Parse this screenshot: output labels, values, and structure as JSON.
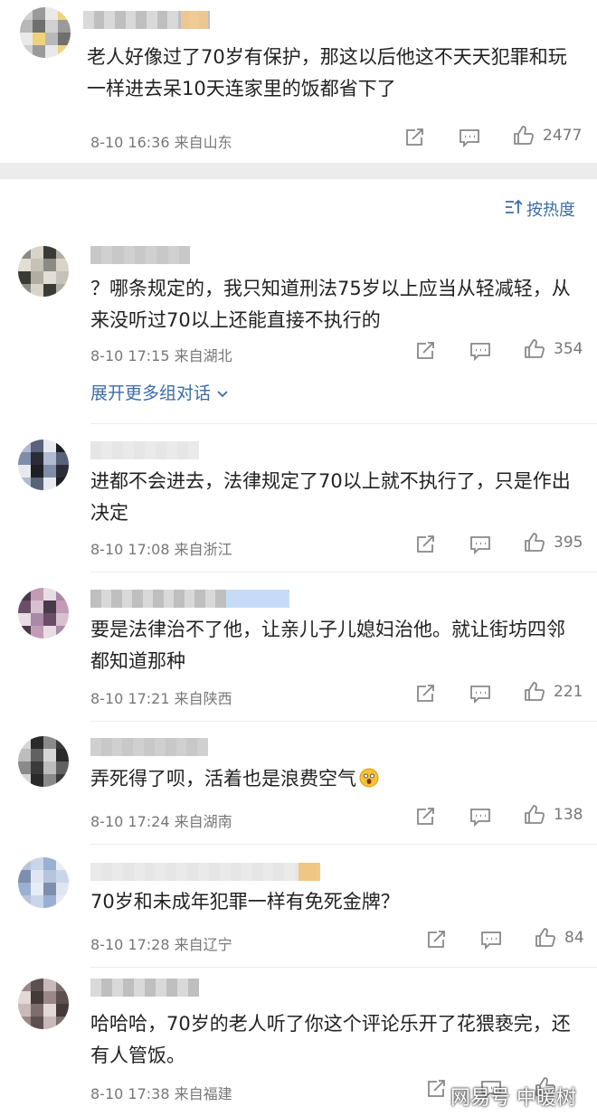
{
  "sort_label": "按热度",
  "expand_more": "展开更多组对话",
  "watermark": "网易号 中暖树",
  "colors": {
    "accent": "#3a6da8",
    "meta": "#777777",
    "separator": "#ececec"
  },
  "comments": [
    {
      "text": "老人好像过了70岁有保护，那这以后他这不天天犯罪和玩一样进去呆10天连家里的饭都省下了",
      "time": "8-10 16:36",
      "location": "来自山东",
      "likes": "2477"
    },
    {
      "text": "？哪条规定的，我只知道刑法75岁以上应当从轻减轻，从来没听过70以上还能直接不执行的",
      "time": "8-10 17:15",
      "location": "来自湖北",
      "likes": "354"
    },
    {
      "text": "进都不会进去，法律规定了70以上就不执行了，只是作出决定",
      "time": "8-10 17:08",
      "location": "来自浙江",
      "likes": "395"
    },
    {
      "text": "要是法律治不了他，让亲儿子儿媳妇治他。就让街坊四邻都知道那种",
      "time": "8-10 17:21",
      "location": "来自陕西",
      "likes": "221"
    },
    {
      "text": "弄死得了呗，活着也是浪费空气",
      "time": "8-10 17:24",
      "location": "来自湖南",
      "likes": "138"
    },
    {
      "text": "70岁和未成年犯罪一样有免死金牌？",
      "time": "8-10 17:28",
      "location": "来自辽宁",
      "likes": "84"
    },
    {
      "text": "哈哈哈，70岁的老人听了你这个评论乐开了花猥亵完，还有人管饭。",
      "time": "8-10 17:38",
      "location": "来自福建",
      "likes": ""
    }
  ]
}
